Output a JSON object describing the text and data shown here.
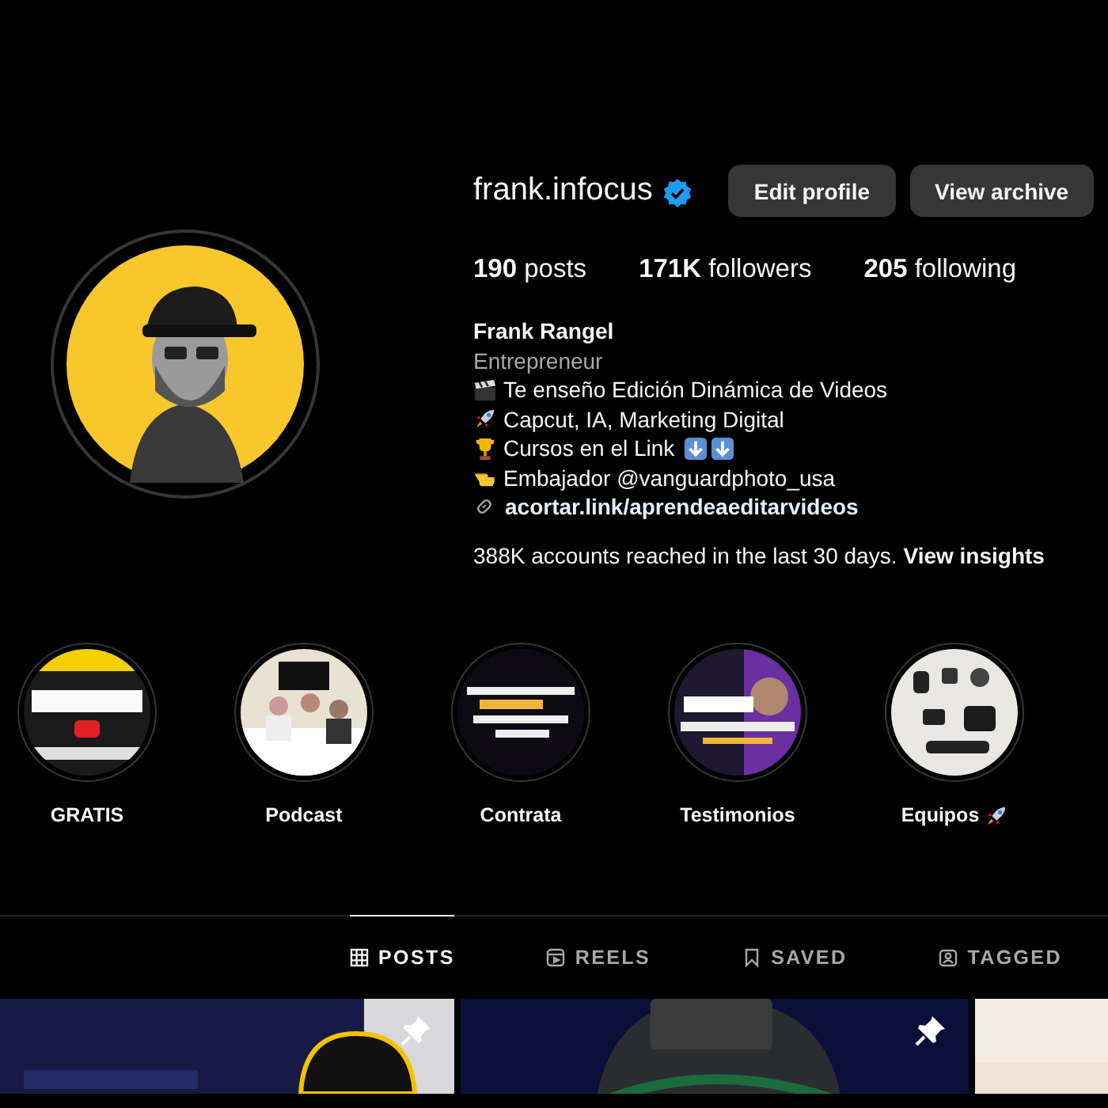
{
  "profile": {
    "username": "frank.infocus",
    "verified": true,
    "buttons": [
      "Edit profile",
      "View archive"
    ],
    "stats": [
      "**190** posts",
      "**171K** followers",
      "**205** following"
    ],
    "name": "Frank Rangel",
    "category": "Entrepreneur",
    "bio": [
      {
        "text": "Te enseño Edición Dinámica de Videos"
      },
      {
        "text": "Capcut, IA, Marketing Digital"
      },
      {
        "text": "Cursos en el Link"
      },
      {
        "text": "Embajador @vanguardphoto_usa"
      }
    ],
    "link": "acortar.link/aprendeaeditarvideos",
    "insights": "388K accounts reached in the last 30 days.",
    "insights_link": "View insights"
  },
  "highlights": [
    {
      "label": "GRATIS"
    },
    {
      "label": "Podcast"
    },
    {
      "label": "Contrata"
    },
    {
      "label": "Testimonios"
    },
    {
      "label": "Equipos"
    }
  ],
  "tabs": [
    {
      "label": "POSTS",
      "selected": true
    },
    {
      "label": "REELS",
      "selected": false
    },
    {
      "label": "SAVED",
      "selected": false
    },
    {
      "label": "TAGGED",
      "selected": false
    }
  ],
  "posts": [
    {
      "pinned": true
    },
    {
      "pinned": true
    },
    {
      "pinned": false
    }
  ]
}
